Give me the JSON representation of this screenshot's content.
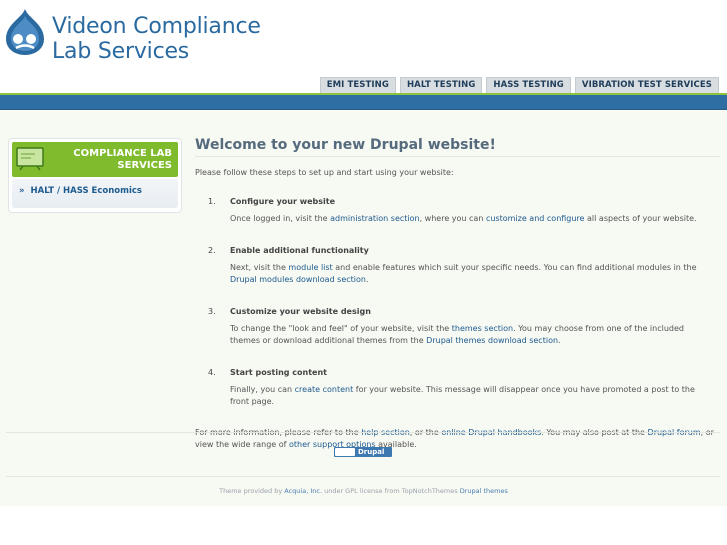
{
  "header": {
    "site_name_line1": "Videon Compliance",
    "site_name_line2": "Lab Services"
  },
  "nav": [
    {
      "label": "EMI TESTING"
    },
    {
      "label": "HALT TESTING"
    },
    {
      "label": "HASS TESTING"
    },
    {
      "label": "VIBRATION TEST SERVICES"
    }
  ],
  "sidebar": {
    "title_line1": "COMPLIANCE LAB",
    "title_line2": "SERVICES",
    "bullet": "»",
    "item": "HALT / HASS Economics"
  },
  "main": {
    "title": "Welcome to your new Drupal website!",
    "intro": "Please follow these steps to set up and start using your website:",
    "steps": [
      {
        "num": "1.",
        "head": "Configure your website",
        "t1": "Once logged in, visit the ",
        "l1": "administration section",
        "t2": ", where you can ",
        "l2": "customize and configure",
        "t3": " all aspects of your website."
      },
      {
        "num": "2.",
        "head": "Enable additional functionality",
        "t1": "Next, visit the ",
        "l1": "module list",
        "t2": " and enable features which suit your specific needs. You can find additional modules in the ",
        "l2": "Drupal modules download section",
        "t3": "."
      },
      {
        "num": "3.",
        "head": "Customize your website design",
        "t1": "To change the \"look and feel\" of your website, visit the ",
        "l1": "themes section",
        "t2": ". You may choose from one of the included themes or download additional themes from the ",
        "l2": "Drupal themes download section",
        "t3": "."
      },
      {
        "num": "4.",
        "head": "Start posting content",
        "t1": "Finally, you can ",
        "l1": "create content",
        "t2": " for your website. This message will disappear once you have promoted a post to the front page."
      }
    ],
    "more": {
      "t1": "For more information, please refer to the ",
      "l1": "help section",
      "t2": ", or the ",
      "l2": "online Drupal handbooks",
      "t3": ". You may also post at the ",
      "l3": "Drupal forum",
      "t4": ", or view the wide range of ",
      "l4": "other support options",
      "t5": " available."
    }
  },
  "footer": {
    "badge": "Drupal",
    "c1": "Theme provided by ",
    "c_link1": "Acquia, Inc.",
    "c2": " under GPL license from TopNotchThemes ",
    "c_link2": "Drupal themes"
  },
  "colors": {
    "accent_green": "#8cc43b",
    "bar_blue": "#2f6ea2",
    "link_blue": "#1d5a8e"
  }
}
